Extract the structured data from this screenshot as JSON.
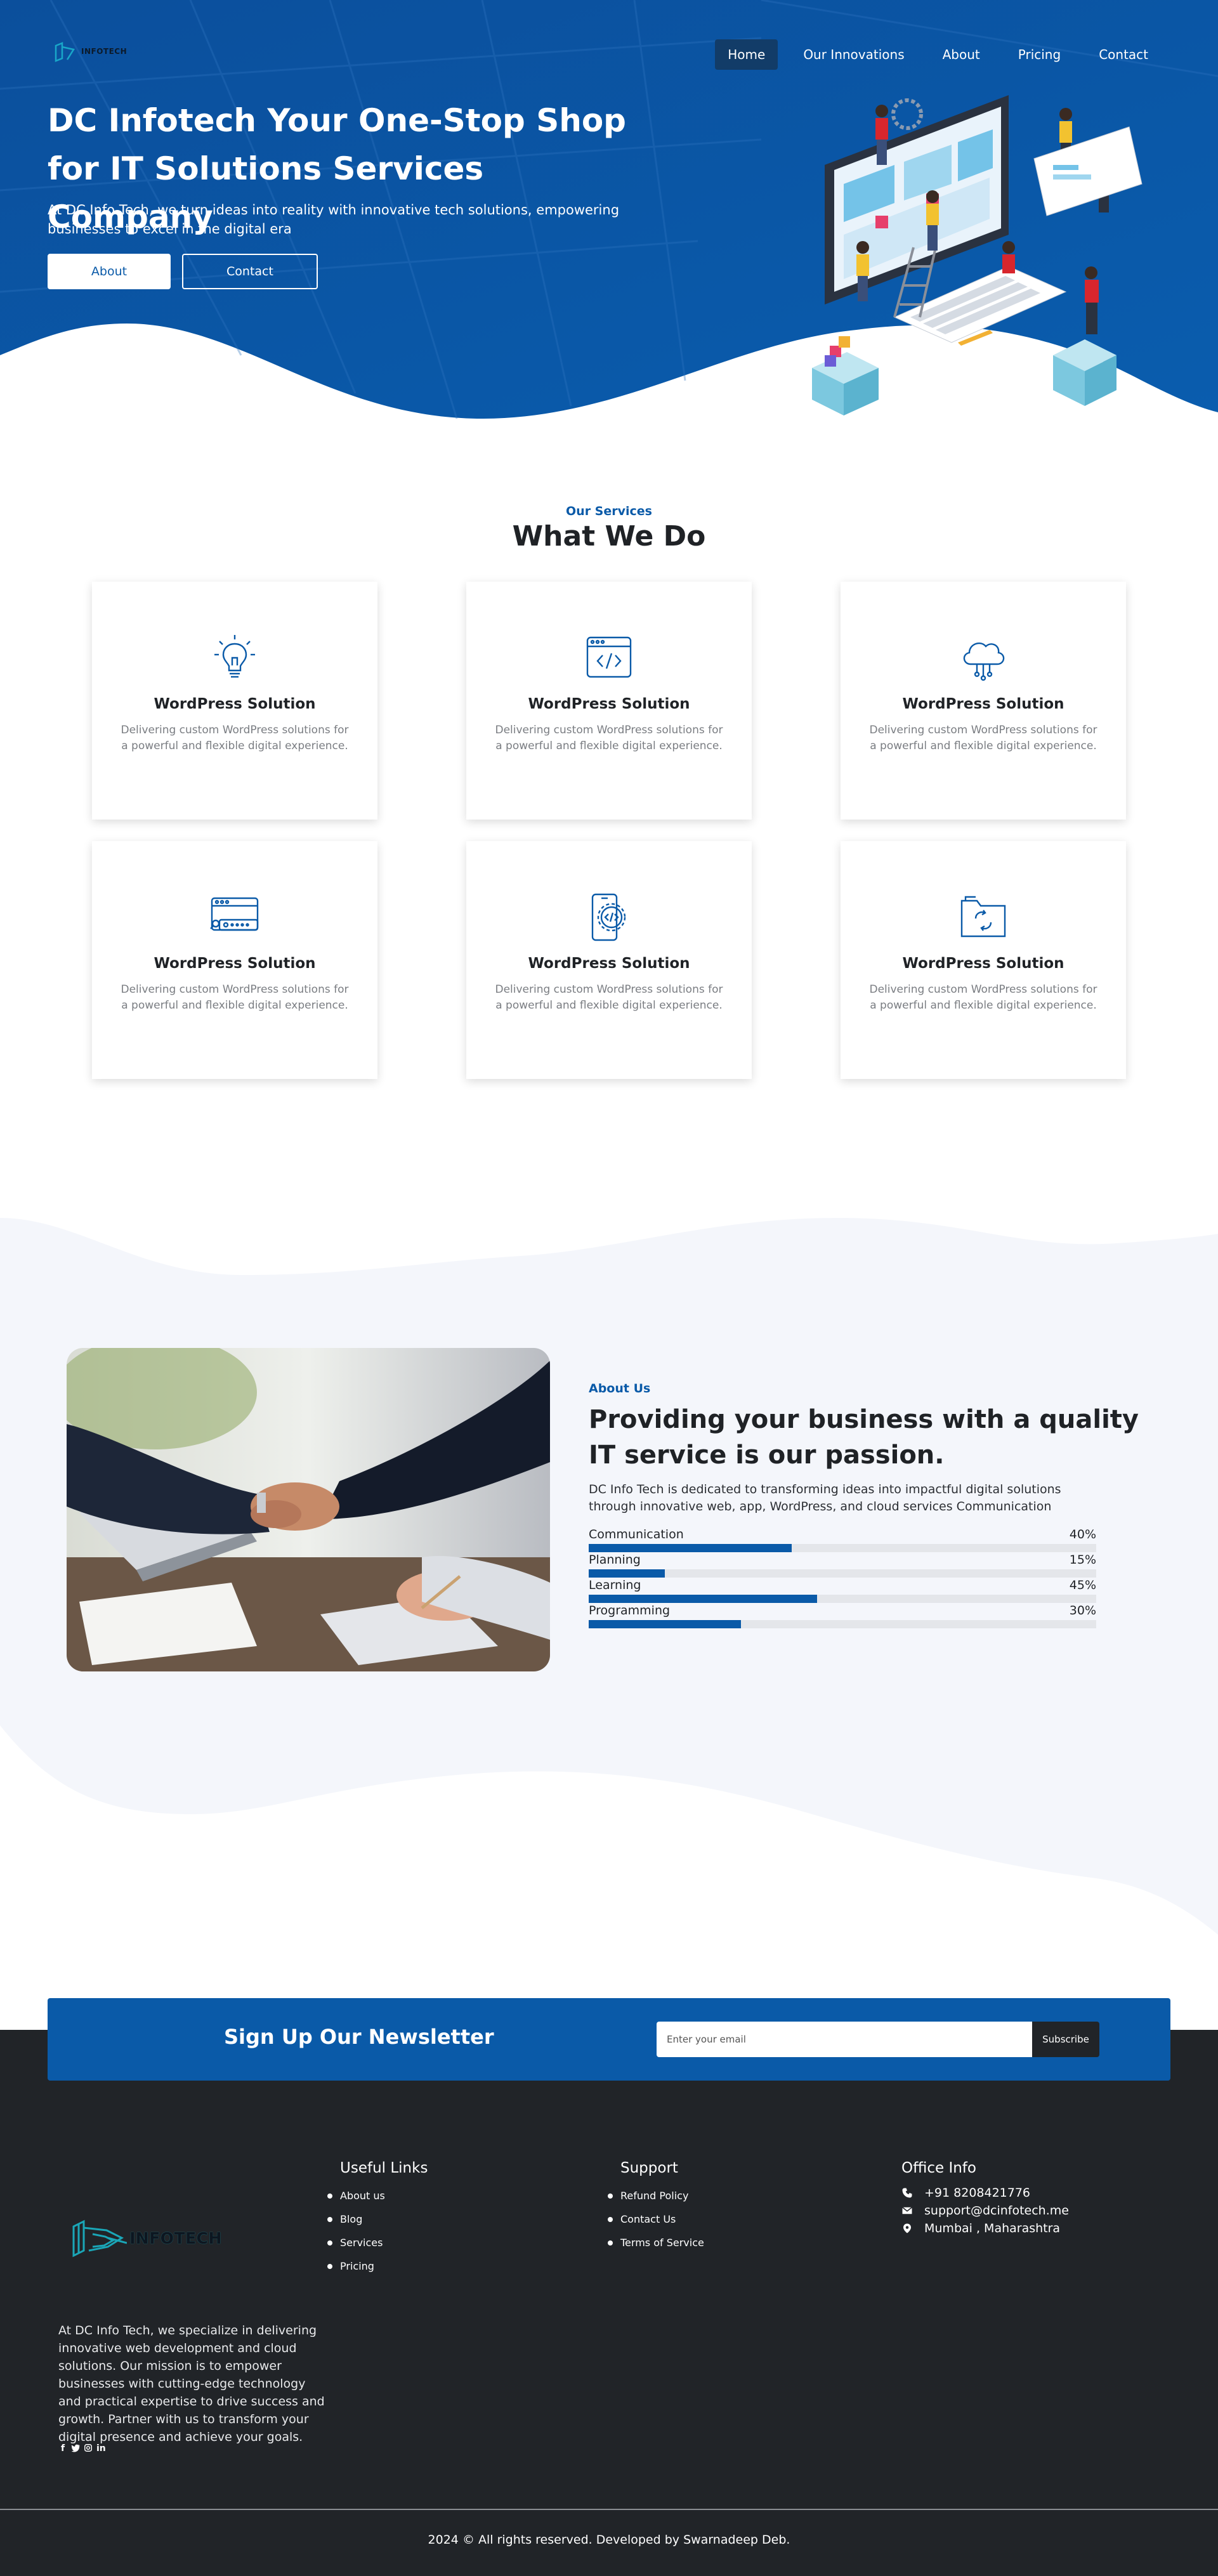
{
  "brand": {
    "name": "INFOTECH"
  },
  "nav": {
    "items": [
      {
        "label": "Home",
        "active": true
      },
      {
        "label": "Our Innovations",
        "active": false
      },
      {
        "label": "About",
        "active": false
      },
      {
        "label": "Pricing",
        "active": false
      },
      {
        "label": "Contact",
        "active": false
      }
    ]
  },
  "hero": {
    "title": "DC Infotech Your One-Stop Shop for IT Solutions Services Company",
    "subtitle": "At DC Info Tech, we turn ideas into reality with innovative tech solutions, empowering businesses to excel in the digital era",
    "about_button": "About",
    "contact_button": "Contact"
  },
  "services": {
    "eyebrow": "Our Services",
    "title": "What We Do",
    "cards": [
      {
        "icon": "lightbulb-icon",
        "title": "WordPress Solution",
        "desc": "Delivering custom WordPress solutions for a powerful and flexible digital experience."
      },
      {
        "icon": "code-window-icon",
        "title": "WordPress Solution",
        "desc": "Delivering custom WordPress solutions for a powerful and flexible digital experience."
      },
      {
        "icon": "cloud-network-icon",
        "title": "WordPress Solution",
        "desc": "Delivering custom WordPress solutions for a powerful and flexible digital experience."
      },
      {
        "icon": "browser-login-icon",
        "title": "WordPress Solution",
        "desc": "Delivering custom WordPress solutions for a powerful and flexible digital experience."
      },
      {
        "icon": "mobile-code-gear-icon",
        "title": "WordPress Solution",
        "desc": "Delivering custom WordPress solutions for a powerful and flexible digital experience."
      },
      {
        "icon": "folder-sync-icon",
        "title": "WordPress Solution",
        "desc": "Delivering custom WordPress solutions for a powerful and flexible digital experience."
      }
    ]
  },
  "about": {
    "eyebrow": "About Us",
    "title": "Providing your business with a quality IT service is our passion.",
    "text": "DC Info Tech is dedicated to transforming ideas into impactful digital solutions through innovative web, app, WordPress, and cloud services Communication",
    "skills": [
      {
        "label": "Communication",
        "percent": "40%",
        "value": 40
      },
      {
        "label": "Planning",
        "percent": "15%",
        "value": 15
      },
      {
        "label": "Learning",
        "percent": "45%",
        "value": 45
      },
      {
        "label": "Programming",
        "percent": "30%",
        "value": 30
      }
    ]
  },
  "newsletter": {
    "title": "Sign Up Our Newsletter",
    "placeholder": "Enter your email",
    "button": "Subscribe"
  },
  "footer": {
    "about": "At DC Info Tech, we specialize in delivering innovative web development and cloud solutions. Our mission is to empower businesses with cutting-edge technology and practical expertise to drive success and growth. Partner with us to transform your digital presence and achieve your goals.",
    "social": [
      "facebook-icon",
      "twitter-icon",
      "instagram-icon",
      "linkedin-icon"
    ],
    "useful_links": {
      "title": "Useful Links",
      "items": [
        "About us",
        "Blog",
        "Services",
        "Pricing"
      ]
    },
    "support": {
      "title": "Support",
      "items": [
        "Refund Policy",
        "Contact Us",
        "Terms of Service"
      ]
    },
    "office": {
      "title": "Office Info",
      "phone": "+91 8208421776",
      "email": "support@dcinfotech.me",
      "address": "Mumbai , Maharashtra"
    },
    "copyright": "2024 © All rights reserved. Developed by Swarnadeep Deb."
  },
  "colors": {
    "primary": "#0a5aa8",
    "dark": "#212428",
    "band": "#f4f6fb"
  }
}
